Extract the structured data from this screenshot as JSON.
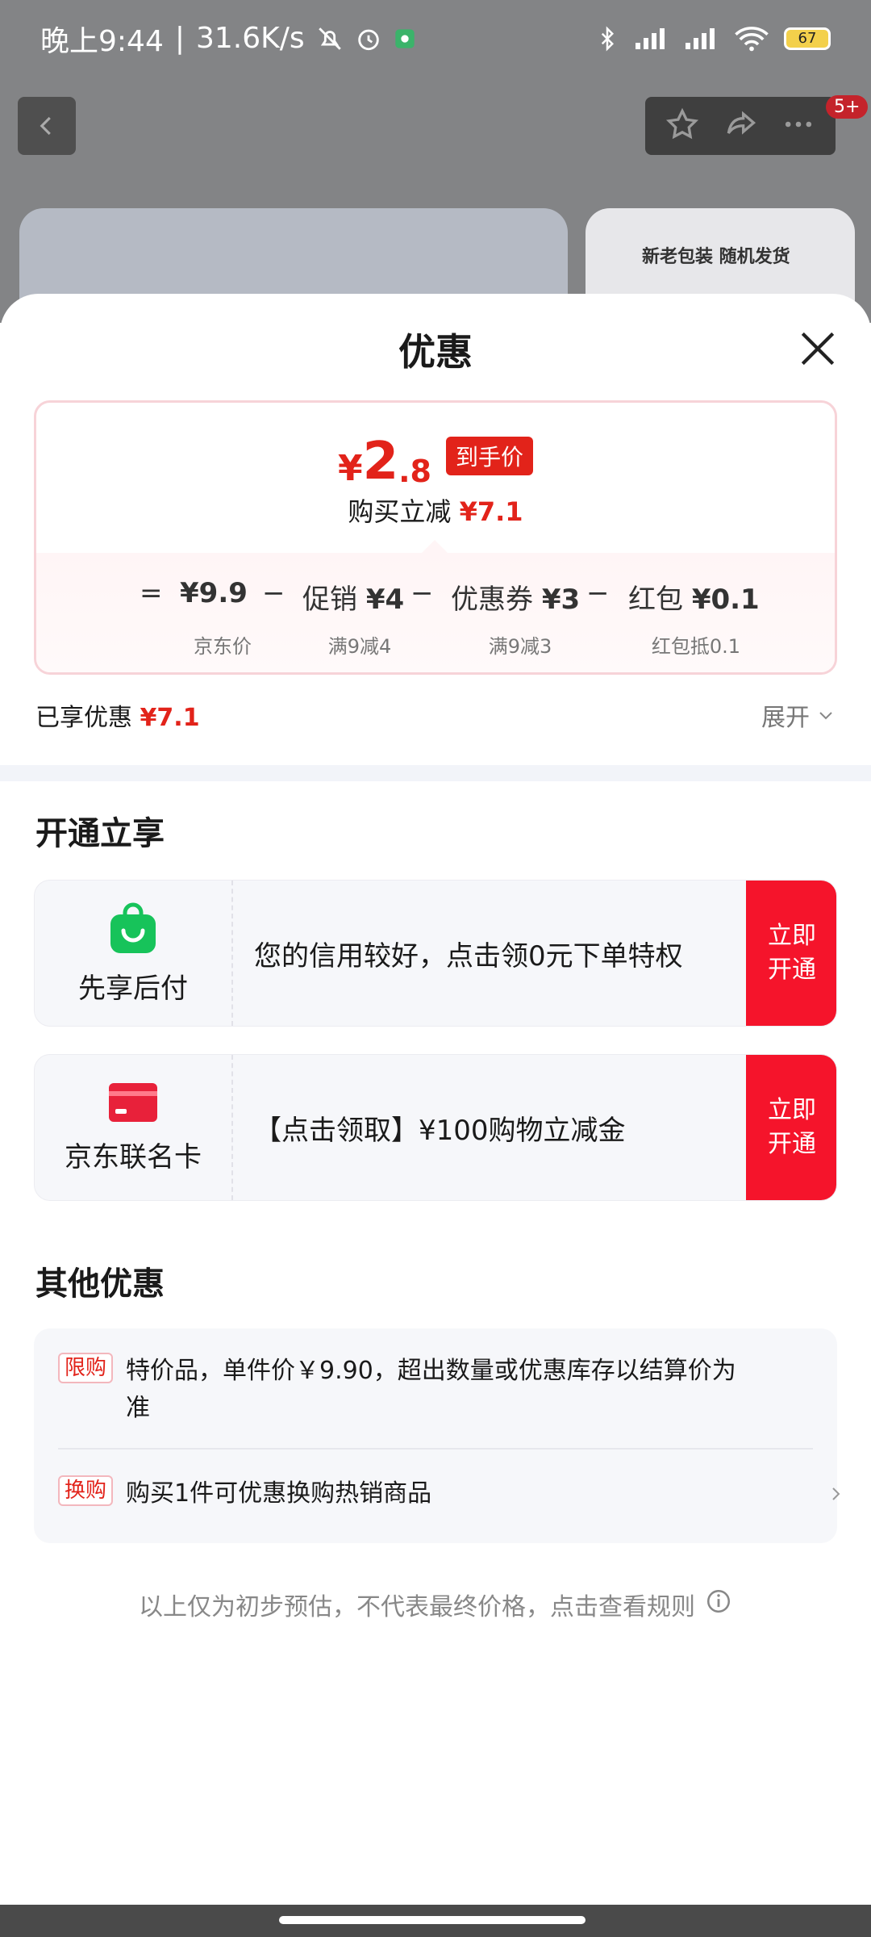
{
  "status_bar": {
    "time": "晚上9:44",
    "speed": "31.6K/s",
    "battery": "67"
  },
  "background": {
    "badge": "5+",
    "card_text": "新老包装 随机发货"
  },
  "sheet": {
    "title": "优惠",
    "price": {
      "yen": "¥",
      "integer": "2",
      "decimal": ".8",
      "tag": "到手价",
      "sub_prefix": "购买立减",
      "sub_amount": "¥7.1"
    },
    "formula": [
      {
        "op": "=",
        "label": "",
        "value": "¥9.9",
        "note": "京东价"
      },
      {
        "op": "−",
        "label": "促销",
        "value": "¥4",
        "note": "满9减4"
      },
      {
        "op": "−",
        "label": "优惠券",
        "value": "¥3",
        "note": "满9减3"
      },
      {
        "op": "−",
        "label": "红包",
        "value": "¥0.1",
        "note": "红包抵0.1"
      }
    ],
    "enjoyed_label": "已享优惠",
    "enjoyed_amount": "¥7.1",
    "expand_label": "展开",
    "open_section_title": "开通立享",
    "offers": [
      {
        "name": "先享后付",
        "text": "您的信用较好，点击领0元下单特权",
        "button": "立即\n开通",
        "icon": "shopping-bag-icon",
        "color": "#17c35a"
      },
      {
        "name": "京东联名卡",
        "text": "【点击领取】¥100购物立减金",
        "button": "立即\n开通",
        "icon": "credit-card-icon",
        "color": "#e8213a"
      }
    ],
    "other_section_title": "其他优惠",
    "other_items": [
      {
        "tag": "限购",
        "text": "特价品，单件价￥9.90，超出数量或优惠库存以结算价为准"
      },
      {
        "tag": "换购",
        "text": "购买1件可优惠换购热销商品"
      }
    ],
    "disclaimer": "以上仅为初步预估，不代表最终价格，点击查看规则"
  },
  "colors": {
    "accent_red": "#e2231a",
    "button_red": "#f5142b",
    "green": "#17c35a"
  }
}
